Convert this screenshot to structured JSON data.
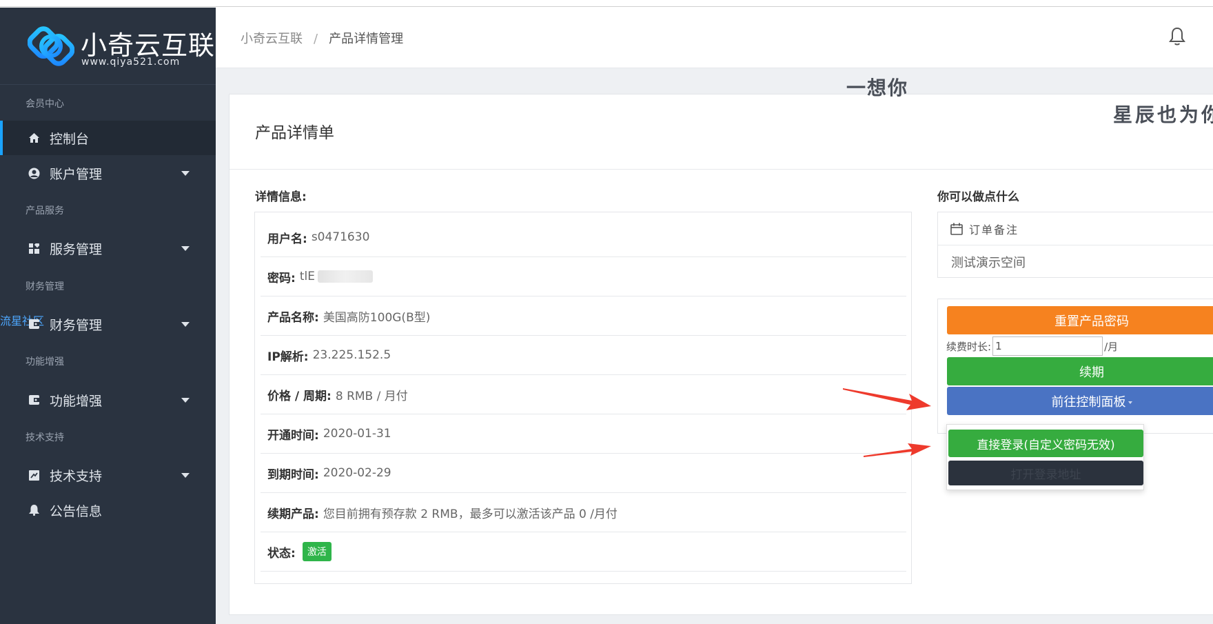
{
  "brand": {
    "name": "小奇云互联",
    "url": "www.qiya521.com"
  },
  "sidebar": {
    "watermark": "流星社区",
    "sections": [
      {
        "title": "会员中心"
      },
      {
        "title": "产品服务"
      },
      {
        "title": "财务管理"
      },
      {
        "title": "功能增强"
      },
      {
        "title": "技术支持"
      }
    ],
    "items": [
      {
        "label": "控制台",
        "icon": "home-icon"
      },
      {
        "label": "账户管理",
        "icon": "user-circle-icon"
      },
      {
        "label": "服务管理",
        "icon": "grid-icon"
      },
      {
        "label": "财务管理",
        "icon": "wallet-icon"
      },
      {
        "label": "功能增强",
        "icon": "wallet-icon"
      },
      {
        "label": "技术支持",
        "icon": "ticket-icon"
      },
      {
        "label": "公告信息",
        "icon": "bell-icon"
      }
    ]
  },
  "header": {
    "breadcrumb": {
      "home": "小奇云互联",
      "separator": "/",
      "current": "产品详情管理"
    }
  },
  "watermarks": {
    "top": "一想你",
    "right": "星辰也为你"
  },
  "card": {
    "title": "产品详情单",
    "details_label": "详情信息:",
    "details": [
      {
        "key": "用户名:",
        "value": "s0471630"
      },
      {
        "key": "密码:",
        "value": "tlE"
      },
      {
        "key": "产品名称:",
        "value": "美国高防100G(B型)"
      },
      {
        "key": "IP解析:",
        "value": "23.225.152.5"
      },
      {
        "key": "价格 / 周期:",
        "value": " 8 RMB / 月付"
      },
      {
        "key": "开通时间:",
        "value": "2020-01-31"
      },
      {
        "key": "到期时间:",
        "value": "2020-02-29"
      },
      {
        "key": "续期产品:",
        "value": " 您目前拥有预存款 2 RMB，最多可以激活该产品 0 /月付"
      },
      {
        "key": "状态:",
        "badge": "激活"
      }
    ],
    "actions_label": "你可以做点什么",
    "notes": {
      "title": "订单备注",
      "content": "测试演示空间"
    },
    "actions": {
      "reset_password": "重置产品密码",
      "renew_label": "续费时长:",
      "renew_value": "1",
      "renew_unit": "/月",
      "renew_button": "续期",
      "control_panel": "前往控制面板"
    },
    "dropdown": {
      "direct_login": "直接登录(自定义密码无效)",
      "open_login": "打开登录地址"
    }
  },
  "colors": {
    "sidebar_bg": "#2a3340",
    "active_accent": "#1aa3ff",
    "orange": "#f6821f",
    "green": "#36ac3f",
    "blue": "#4a73c3",
    "dark": "#2b323d",
    "arrow": "#ee3a2c"
  }
}
